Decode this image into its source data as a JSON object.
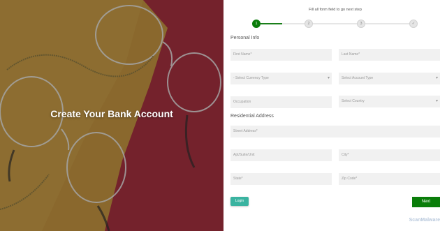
{
  "hero": {
    "title": "Create Your Bank Account"
  },
  "header": {
    "instruction": "Fill all form field to go next step"
  },
  "steps": [
    {
      "label": "1",
      "state": "active"
    },
    {
      "label": "2",
      "state": "pending"
    },
    {
      "label": "3",
      "state": "pending"
    },
    {
      "label": "✓",
      "state": "pending"
    }
  ],
  "personal": {
    "title": "Personal Info",
    "first_name": "First Name*",
    "last_name": "Last Name*",
    "currency": "- Select Currency Type",
    "account_type": "Select Account Type",
    "occupation": "Occupation",
    "country": "Select Country"
  },
  "residential": {
    "title": "Residential Address",
    "street": "Street Address*",
    "apt": "Apt/Suite/Unit",
    "city": "City*",
    "state": "State*",
    "zip": "Zip Code*"
  },
  "buttons": {
    "login": "Login",
    "next": "Next"
  },
  "watermark": "ScanMalware",
  "colors": {
    "accent": "#0a7d0a",
    "login": "#3ab3a0",
    "hero_mustard": "#b58c3c",
    "hero_red": "#9a2f3c"
  }
}
